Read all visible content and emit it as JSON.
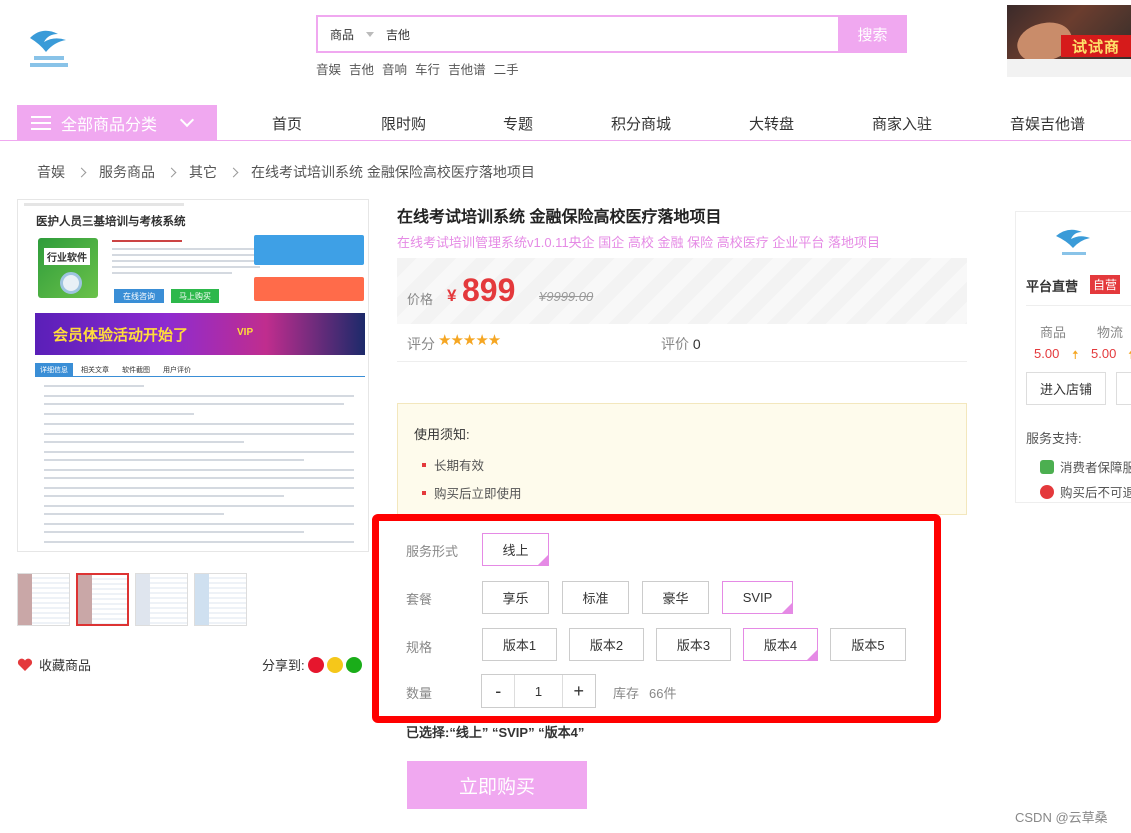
{
  "header": {
    "search": {
      "category": "商品",
      "value": "吉他",
      "button": "搜索"
    },
    "hot_words": [
      "音娱",
      "吉他",
      "音响",
      "车行",
      "吉他谱",
      "二手"
    ],
    "ad_text": "试试商"
  },
  "nav": {
    "category_menu": "全部商品分类",
    "items": [
      "首页",
      "限时购",
      "专题",
      "积分商城",
      "大转盘",
      "商家入驻",
      "音娱吉他谱"
    ]
  },
  "breadcrumb": [
    "音娱",
    "服务商品",
    "其它",
    "在线考试培训系统 金融保险高校医疗落地项目"
  ],
  "gallery": {
    "main_image": {
      "title": "医护人员三基培训与考核系统",
      "box_label": "行业软件",
      "btn_online": "在线咨询",
      "btn_buy": "马上购买",
      "banner": "会员体验活动开始了",
      "tabs": [
        "详细信息",
        "相关文章",
        "软件截图",
        "用户评价"
      ],
      "vip": "VIP"
    },
    "favorite": "收藏商品",
    "share": "分享到:"
  },
  "product": {
    "title": "在线考试培训系统 金融保险高校医疗落地项目",
    "subtitle": "在线考试培训管理系统v1.0.11央企 国企 高校 金融 保险 高校医疗 企业平台 落地项目",
    "price_label": "价格",
    "currency": "¥",
    "price": "899",
    "original_price": "¥9999.00",
    "rating_label": "评分",
    "stars": "★★★★★",
    "review_label": "评价",
    "review_count": "0",
    "notice": {
      "title": "使用须知:",
      "items": [
        "长期有效",
        "购买后立即使用"
      ]
    },
    "options": {
      "service_label": "服务形式",
      "service_values": [
        "线上"
      ],
      "package_label": "套餐",
      "package_values": [
        "享乐",
        "标准",
        "豪华",
        "SVIP"
      ],
      "spec_label": "规格",
      "spec_values": [
        "版本1",
        "版本2",
        "版本3",
        "版本4",
        "版本5"
      ],
      "qty_label": "数量",
      "qty_minus": "-",
      "qty_value": "1",
      "qty_plus": "+",
      "stock_label": "库存",
      "stock_value": "66件"
    },
    "selected_text": "已选择:“线上” “SVIP” “版本4”",
    "buy_button": "立即购买"
  },
  "store": {
    "name": "平台直营",
    "badge": "自营",
    "score_labels": [
      "商品",
      "物流"
    ],
    "score_values": [
      "5.00",
      "5.00"
    ],
    "enter_button": "进入店铺",
    "service_label": "服务支持:",
    "services": [
      "消费者保障服",
      "购买后不可退"
    ]
  },
  "watermark": "CSDN @云草桑",
  "colors": {
    "accent_pink": "#f0a8f0",
    "price_red": "#e4393c",
    "frame_red": "#ff0000"
  }
}
